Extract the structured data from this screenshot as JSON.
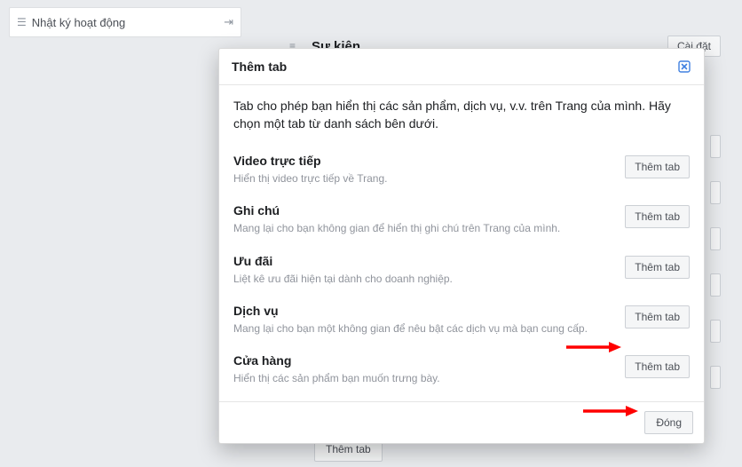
{
  "sidebar": {
    "activity_log_label": "Nhật ký hoạt động"
  },
  "background": {
    "event_row_title": "Sự kiện",
    "settings_button_label": "Cài đặt",
    "add_tab_button_label": "Thêm tab"
  },
  "modal": {
    "title": "Thêm tab",
    "intro": "Tab cho phép bạn hiển thị các sản phẩm, dịch vụ, v.v. trên Trang của mình. Hãy chọn một tab từ danh sách bên dưới.",
    "add_button_label": "Thêm tab",
    "close_button_label": "Đóng",
    "options": [
      {
        "title": "Video trực tiếp",
        "desc": "Hiển thị video trực tiếp về Trang."
      },
      {
        "title": "Ghi chú",
        "desc": "Mang lại cho bạn không gian để hiển thị ghi chú trên Trang của mình."
      },
      {
        "title": "Ưu đãi",
        "desc": "Liệt kê ưu đãi hiện tại dành cho doanh nghiệp."
      },
      {
        "title": "Dịch vụ",
        "desc": "Mang lại cho bạn một không gian để nêu bật các dịch vụ mà bạn cung cấp."
      },
      {
        "title": "Cửa hàng",
        "desc": "Hiển thị các sản phẩm bạn muốn trưng bày."
      }
    ]
  },
  "colors": {
    "accent": "#1877f2",
    "arrow": "#ff0000"
  }
}
